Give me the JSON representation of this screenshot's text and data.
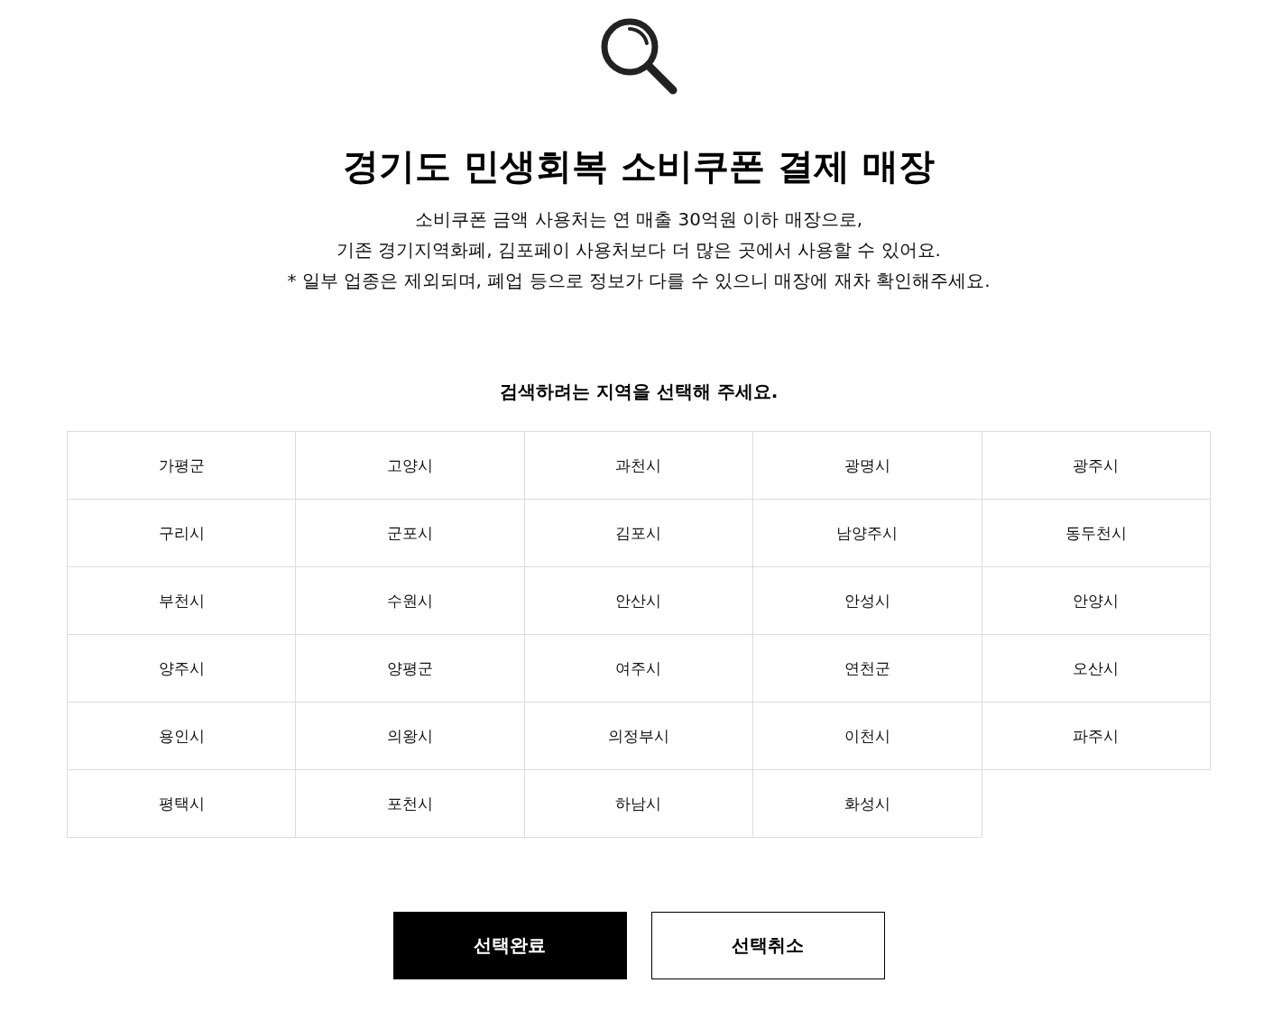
{
  "header": {
    "title": "경기도 민생회복 소비쿠폰 결제 매장",
    "description_lines": [
      "소비쿠폰 금액 사용처는 연 매출 30억원 이하 매장으로,",
      "기존 경기지역화폐, 김포페이 사용처보다 더 많은 곳에서 사용할 수 있어요.",
      "* 일부 업종은 제외되며, 폐업 등으로 정보가 다를 수 있으니 매장에 재차 확인해주세요."
    ]
  },
  "region_picker": {
    "prompt": "검색하려는 지역을 선택해 주세요.",
    "regions": [
      {
        "name": "가평군",
        "selected": false
      },
      {
        "name": "고양시",
        "selected": false
      },
      {
        "name": "과천시",
        "selected": false
      },
      {
        "name": "광명시",
        "selected": false
      },
      {
        "name": "광주시",
        "selected": false
      },
      {
        "name": "구리시",
        "selected": false
      },
      {
        "name": "군포시",
        "selected": false
      },
      {
        "name": "김포시",
        "selected": false
      },
      {
        "name": "남양주시",
        "selected": false
      },
      {
        "name": "동두천시",
        "selected": false
      },
      {
        "name": "부천시",
        "selected": false
      },
      {
        "name": "수원시",
        "selected": false
      },
      {
        "name": "안산시",
        "selected": false
      },
      {
        "name": "안성시",
        "selected": false
      },
      {
        "name": "안양시",
        "selected": false
      },
      {
        "name": "양주시",
        "selected": false
      },
      {
        "name": "양평군",
        "selected": false
      },
      {
        "name": "여주시",
        "selected": false
      },
      {
        "name": "연천군",
        "selected": false
      },
      {
        "name": "오산시",
        "selected": false
      },
      {
        "name": "용인시",
        "selected": false
      },
      {
        "name": "의왕시",
        "selected": false
      },
      {
        "name": "의정부시",
        "selected": false
      },
      {
        "name": "이천시",
        "selected": false
      },
      {
        "name": "파주시",
        "selected": false
      },
      {
        "name": "평택시",
        "selected": false
      },
      {
        "name": "포천시",
        "selected": false
      },
      {
        "name": "하남시",
        "selected": false
      },
      {
        "name": "화성시",
        "selected": false
      }
    ]
  },
  "buttons": [
    {
      "label": "선택완료",
      "kind": "primary"
    },
    {
      "label": "선택취소",
      "kind": "secondary"
    }
  ]
}
